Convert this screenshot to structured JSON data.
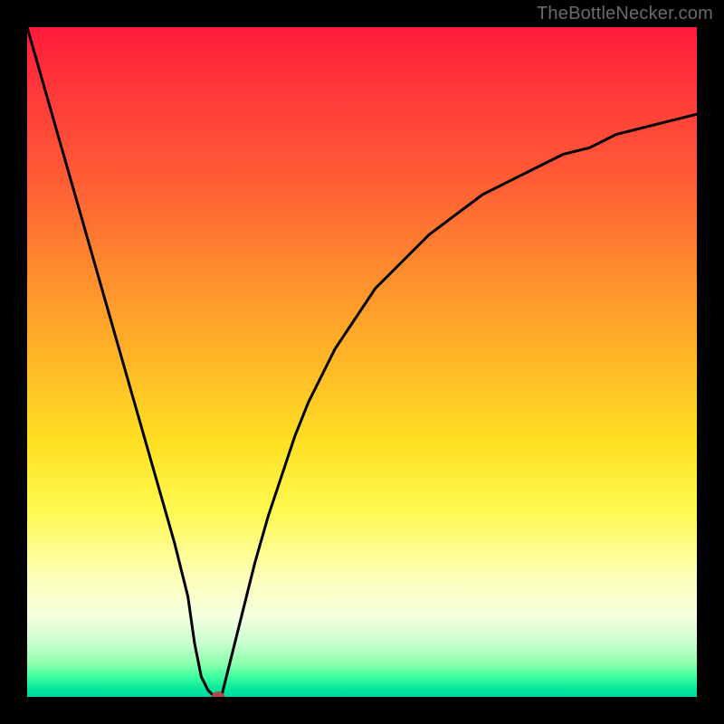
{
  "watermark": "TheBottleNecker.com",
  "colors": {
    "page_bg": "#000000",
    "watermark": "#6a6a6a",
    "curve": "#000000",
    "marker": "#b04a4a"
  },
  "chart_data": {
    "type": "line",
    "title": "",
    "xlabel": "",
    "ylabel": "",
    "xlim": [
      0,
      100
    ],
    "ylim": [
      0,
      100
    ],
    "x": [
      0,
      2,
      4,
      6,
      8,
      10,
      12,
      14,
      16,
      18,
      20,
      22,
      24,
      25,
      26,
      27,
      28,
      29,
      30,
      32,
      34,
      36,
      38,
      40,
      42,
      44,
      46,
      48,
      50,
      52,
      54,
      56,
      58,
      60,
      64,
      68,
      72,
      76,
      80,
      84,
      88,
      92,
      96,
      100
    ],
    "values": [
      100,
      93,
      86,
      79,
      72,
      65,
      58,
      51,
      44,
      37,
      30,
      23,
      15,
      8,
      3,
      1,
      0,
      0,
      4,
      12,
      20,
      27,
      33,
      39,
      44,
      48,
      52,
      55,
      58,
      61,
      63,
      65,
      67,
      69,
      72,
      75,
      77,
      79,
      81,
      82,
      84,
      85,
      86,
      87
    ],
    "marker": {
      "x": 28.5,
      "y": 0
    },
    "gradient_stops": [
      {
        "pos": 0,
        "color": "#ff1a3a"
      },
      {
        "pos": 50,
        "color": "#ffe023"
      },
      {
        "pos": 90,
        "color": "#e8ffd0"
      },
      {
        "pos": 100,
        "color": "#00d8a3"
      }
    ]
  }
}
